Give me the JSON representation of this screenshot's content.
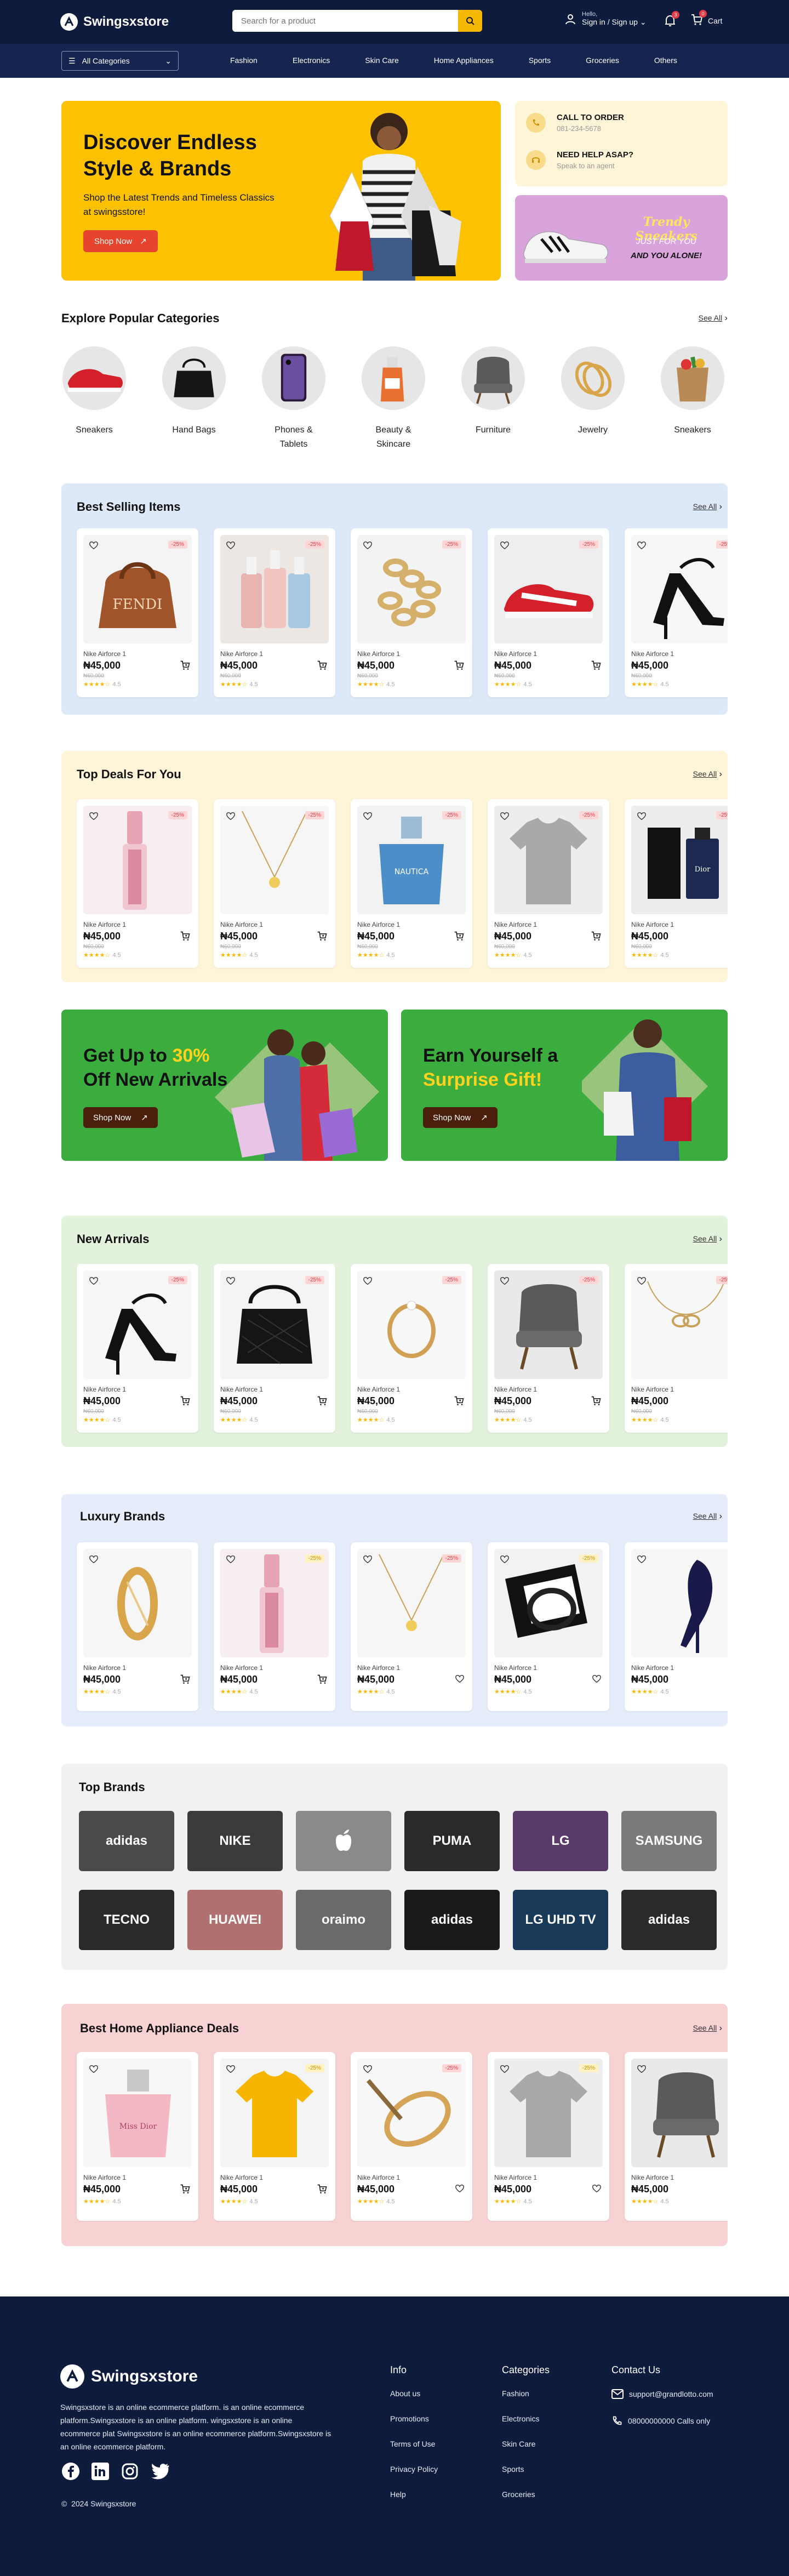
{
  "header": {
    "brand": "Swingsxstore",
    "search_placeholder": "Search for a product",
    "hello": "Hello,",
    "signin": "Sign in / Sign up",
    "cart_label": "Cart",
    "bell_count": "3",
    "cart_count": "0"
  },
  "nav": {
    "all_categories": "All Categories",
    "links": [
      "Fashion",
      "Electronics",
      "Skin Care",
      "Home Appliances",
      "Sports",
      "Groceries",
      "Others"
    ]
  },
  "hero": {
    "title": "Discover Endless Style & Brands",
    "subtitle": "Shop the Latest Trends and Timeless Classics at swingsstore!",
    "cta": "Shop Now"
  },
  "contact": {
    "call_title": "CALL TO ORDER",
    "call_number": "081-234-5678",
    "help_title": "NEED HELP ASAP?",
    "help_sub": "Speak to an agent"
  },
  "trendy": {
    "line1": "Trendy Sneakers",
    "line2": "JUST FOR YOU",
    "line3": "AND YOU ALONE!"
  },
  "categories": {
    "title": "Explore Popular Categories",
    "see_all": "See All",
    "items": [
      "Sneakers",
      "Hand Bags",
      "Phones & Tablets",
      "Beauty & Skincare",
      "Furniture",
      "Jewelry",
      "Sneakers"
    ]
  },
  "product": {
    "name": "Nike Airforce 1",
    "price": "₦45,000",
    "old": "₦60,000",
    "rating": "4.5",
    "discount": "-25%"
  },
  "best_selling": {
    "title": "Best Selling Items",
    "see_all": "See All"
  },
  "top_deals": {
    "title": "Top Deals For You",
    "see_all": "See All"
  },
  "promo1": {
    "line1": "Get Up to ",
    "highlight": "30%",
    "line2": "Off New Arrivals",
    "cta": "Shop Now"
  },
  "promo2": {
    "line1": "Earn Yourself a",
    "line2": "Surprise Gift!",
    "cta": "Shop Now"
  },
  "new_arrivals": {
    "title": "New Arrivals",
    "see_all": "See All"
  },
  "luxury": {
    "title": "Luxury Brands",
    "see_all": "See All"
  },
  "top_brands": {
    "title": "Top Brands",
    "row1": [
      "adidas",
      "NIKE",
      "",
      "PUMA",
      "LG",
      "SAMSUNG"
    ],
    "row2": [
      "TECNO",
      "HUAWEI",
      "oraimo",
      "adidas",
      "LG UHD TV",
      "adidas"
    ]
  },
  "home_appliance": {
    "title": "Best Home Appliance Deals",
    "see_all": "See All"
  },
  "footer": {
    "brand": "Swingsxstore",
    "about": "Swingsxstore is an online ecommerce platform. is an online ecommerce platform.Swingsxstore is an online  platform. wingsxstore is an online ecommerce plat Swingsxstore is an online ecommerce platform.Swingsxstore is an online ecommerce platform.",
    "copyright": "2024 Swingsxstore",
    "info_title": "Info",
    "info": [
      "About us",
      "Promotions",
      "Terms of Use",
      "Privacy Policy",
      "Help"
    ],
    "cat_title": "Categories",
    "cats": [
      "Fashion",
      "Electronics",
      "Skin Care",
      "Sports",
      "Groceries"
    ],
    "contact_title": "Contact Us",
    "email": "support@grandlotto.com",
    "phone": "08000000000 Calls only"
  },
  "colors": {
    "navy": "#0f1b3d",
    "yellow": "#fcc201",
    "red": "#e8432c",
    "green": "#3aad3e"
  }
}
